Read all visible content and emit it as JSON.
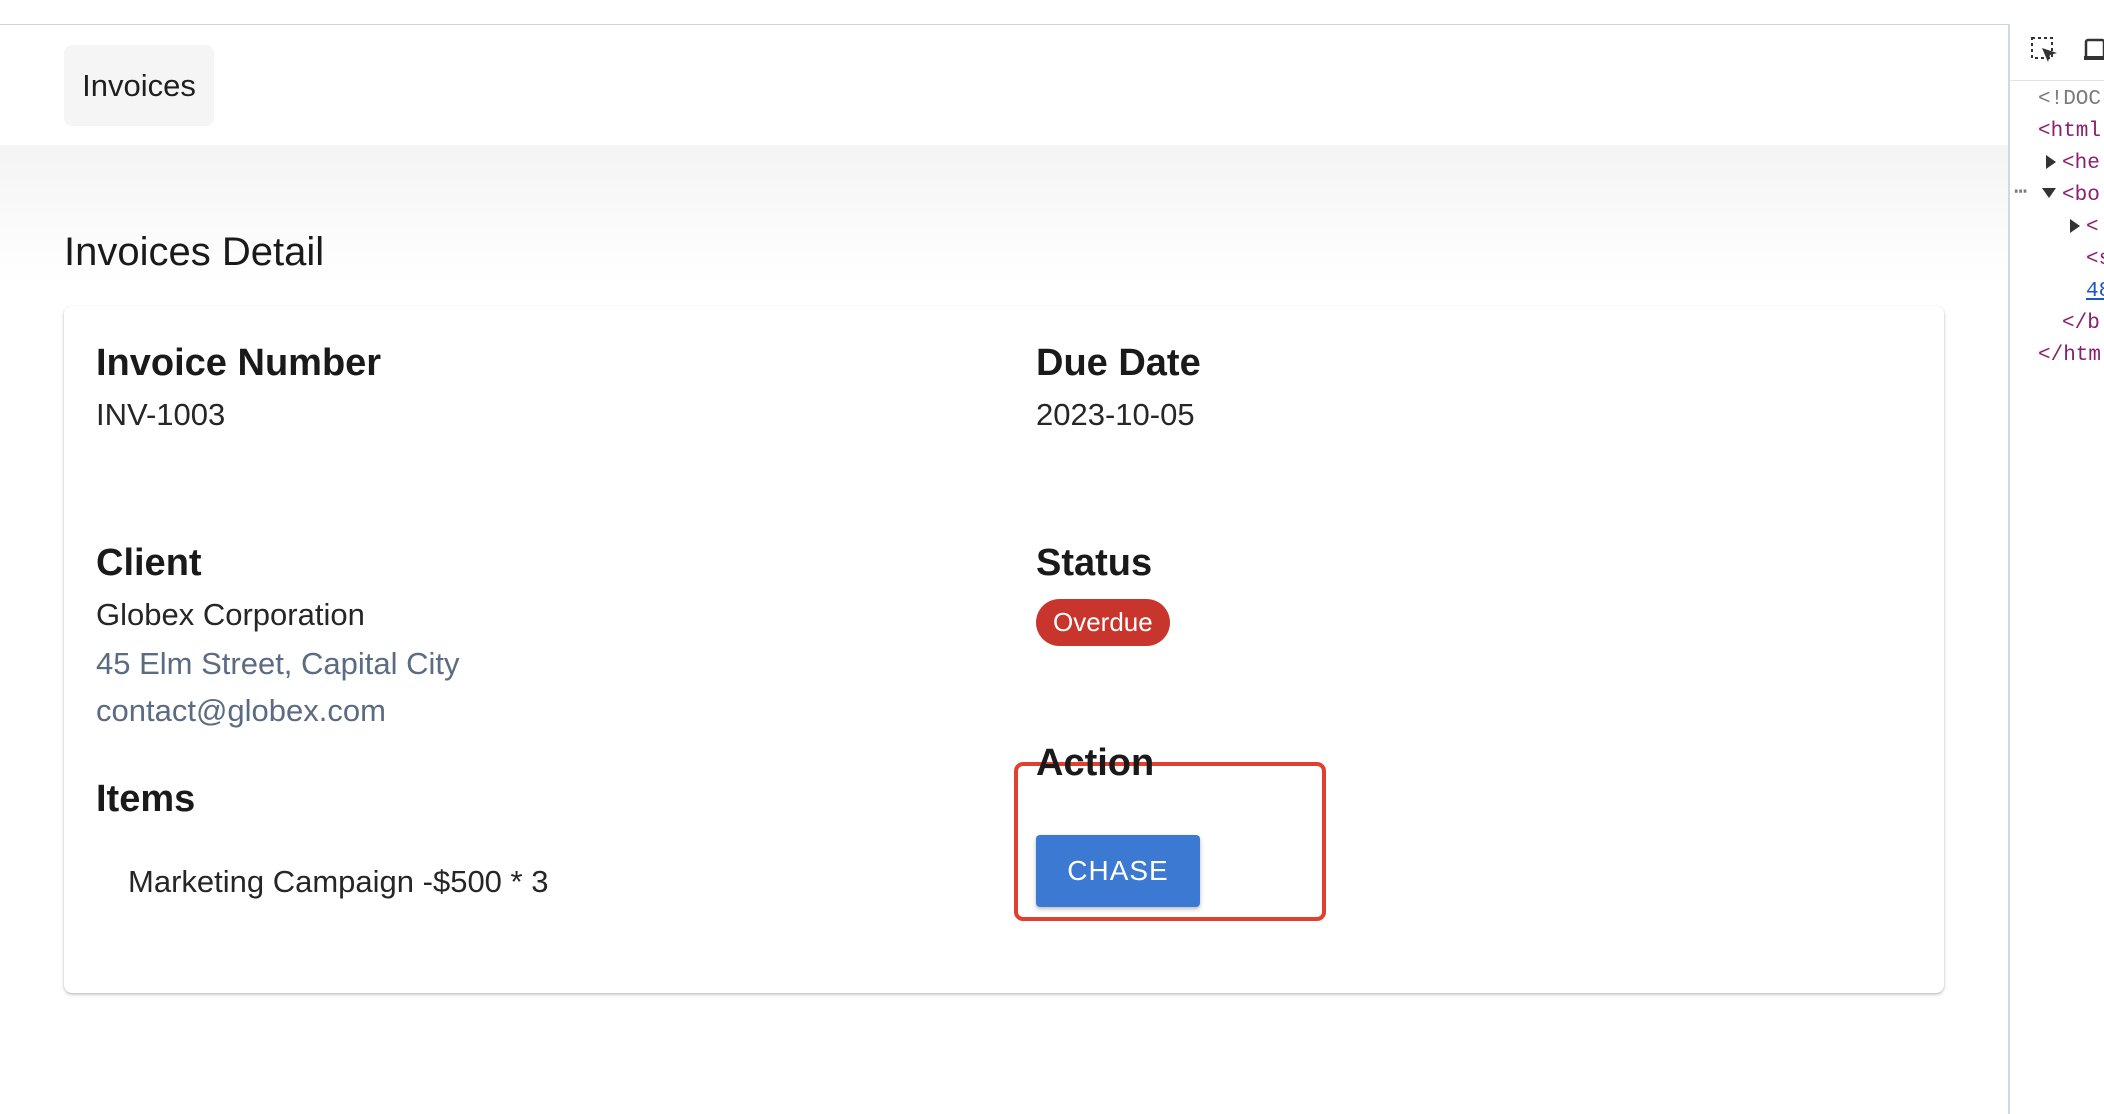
{
  "nav": {
    "invoices_label": "Invoices"
  },
  "page": {
    "title": "Invoices Detail"
  },
  "invoice": {
    "number_label": "Invoice Number",
    "number": "INV-1003",
    "due_label": "Due Date",
    "due_date": "2023-10-05",
    "client_label": "Client",
    "client_name": "Globex Corporation",
    "client_address": "45 Elm Street, Capital City",
    "client_email": "contact@globex.com",
    "status_label": "Status",
    "status": "Overdue",
    "items_label": "Items",
    "items": [
      "Marketing Campaign -$500 * 3"
    ],
    "action_label": "Action",
    "action_button": "CHASE"
  },
  "colors": {
    "status_overdue": "#c8352c",
    "button_primary": "#3b79d2",
    "highlight_border": "#e1402f",
    "muted_text": "#5b6b82"
  },
  "devtools": {
    "toolbar_icons": [
      "inspect-element-icon",
      "device-toolbar-icon"
    ],
    "lines": [
      "<!DOC",
      "<html",
      "<he",
      "<bo",
      "<",
      "<s",
      "48",
      "</b",
      "</htm"
    ]
  }
}
